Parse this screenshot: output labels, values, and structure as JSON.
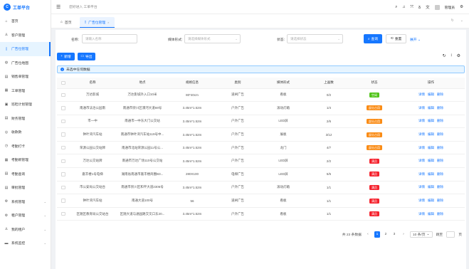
{
  "app": {
    "logo_letter": "C",
    "title": "工单平台"
  },
  "header": {
    "welcome": "您好进入 工单平台",
    "user": "管理员"
  },
  "sidebar": {
    "items": [
      {
        "label": "首页",
        "icon": "home-icon",
        "glyph": "⌂"
      },
      {
        "label": "客户管理",
        "icon": "user-icon",
        "glyph": "♙"
      },
      {
        "label": "广告位管理",
        "icon": "ad-slot-icon",
        "glyph": "▯",
        "active": true
      },
      {
        "label": "广告位地图",
        "icon": "globe-icon",
        "glyph": "◍"
      },
      {
        "label": "销售单管理",
        "icon": "file-icon",
        "glyph": "▤"
      },
      {
        "label": "工单管理",
        "icon": "ticket-icon",
        "glyph": "▦"
      },
      {
        "label": "巡检计划管理",
        "icon": "calendar-icon",
        "glyph": "▣"
      },
      {
        "label": "财务管理",
        "icon": "finance-icon",
        "glyph": "▤"
      },
      {
        "label": "收款款",
        "icon": "payment-icon",
        "glyph": "◎"
      },
      {
        "label": "考勤打卡",
        "icon": "clock-icon",
        "glyph": "◷"
      },
      {
        "label": "考勤新管理",
        "icon": "calendar-check-icon",
        "glyph": "▦"
      },
      {
        "label": "考勤查询",
        "icon": "search-doc-icon",
        "glyph": "▤"
      },
      {
        "label": "审批管理",
        "icon": "approval-icon",
        "glyph": "▤"
      },
      {
        "label": "系统管理",
        "icon": "gear-icon",
        "glyph": "⚙",
        "arrow": "⌄"
      },
      {
        "label": "租户管理",
        "icon": "tenant-icon",
        "glyph": "⚙",
        "arrow": "⌄"
      },
      {
        "label": "我的租户",
        "icon": "person-icon",
        "glyph": "♙",
        "arrow": "⌄"
      },
      {
        "label": "系统监控",
        "icon": "monitor-icon",
        "glyph": "▬",
        "arrow": "⌄"
      }
    ]
  },
  "tabs": [
    {
      "label": "首页",
      "icon": "home-icon",
      "glyph": "⌂"
    },
    {
      "label": "广告位管理",
      "icon": "ad-slot-icon",
      "glyph": "▯",
      "close": "×"
    }
  ],
  "search": {
    "name_label": "名称:",
    "name_placeholder": "请输入名称",
    "media_label": "媒体形式:",
    "media_placeholder": "请选择媒体形式",
    "status_label": "状态:",
    "status_placeholder": "请选择状态",
    "search_btn": "查询",
    "reset_btn": "重置",
    "expand": "展开"
  },
  "toolbar": {
    "add": "新增",
    "export": "导出"
  },
  "alert": {
    "text": "未选中任何数据"
  },
  "table": {
    "headers": [
      "名称",
      "地点",
      "规格信息",
      "类别",
      "媒体形式",
      "上画数",
      "状态",
      "操作"
    ],
    "ops": [
      "详情",
      "编辑",
      "删除"
    ],
    "rows": [
      {
        "name": "万达影城",
        "location": "万达影城外入口10米",
        "spec": "80*40cm",
        "category": "道闸广告",
        "media": "看板",
        "count": "0/2",
        "status": "空闲",
        "status_class": "st-green"
      },
      {
        "name": "南通市法治公园南",
        "location": "南通市崇川区濠河大道69号",
        "spec": "3.45m*1.52m",
        "category": "户外广告",
        "media": "滚动灯箱",
        "count": "1/4",
        "status": "部分占用",
        "status_class": "st-orange"
      },
      {
        "name": "市一中",
        "location": "南通市一中东大门公交站",
        "spec": "3.45m*1.52m",
        "category": "户外广告",
        "media": "LED屏",
        "count": "2/6",
        "status": "部分占用",
        "status_class": "st-orange"
      },
      {
        "name": "钟叶湾汽车站",
        "location": "南通市钟叶湾汽车站119号中...",
        "spec": "3.45m*1.52m",
        "category": "户外广告",
        "media": "展板",
        "count": "3/12",
        "status": "部分占用",
        "status_class": "st-orange"
      },
      {
        "name": "荣源公园公交站牌",
        "location": "南通市北站荣源公园11号公...",
        "spec": "3.45m*1.52m",
        "category": "户外广告",
        "media": "龙门",
        "count": "4/7",
        "status": "部分占用",
        "status_class": "st-orange"
      },
      {
        "name": "万达公交站牌",
        "location": "南通市万达广场110号公交站",
        "spec": "3.45m*1.52m",
        "category": "户外广告",
        "media": "LED屏",
        "count": "2/2",
        "status": "满员",
        "status_class": "st-red"
      },
      {
        "name": "嘉丰楼1号电梯",
        "location": "湖南省南通市嘉丰楼商圈B3...",
        "spec": "280X100",
        "category": "电梯广告",
        "media": "LED屏",
        "count": "5/5",
        "status": "满员",
        "status_class": "st-red"
      },
      {
        "name": "市公安局公交站台",
        "location": "南通市崇川区和平大道2306号",
        "spec": "3.45m*1.52m",
        "category": "户外广告",
        "media": "滚动灯箱",
        "count": "1/1",
        "status": "满员",
        "status_class": "st-red"
      },
      {
        "name": "钟叶湾汽车站",
        "location": "南通大道100号",
        "spec": "56",
        "category": "道闸广告",
        "media": "看板",
        "count": "1/1",
        "status": "满员",
        "status_class": "st-red"
      },
      {
        "name": "区随区教育局公交站台",
        "location": "区随大道与通园路交叉口东20...",
        "spec": "3.45m*1.52m",
        "category": "户外广告",
        "media": "看板",
        "count": "1/1",
        "status": "满员",
        "status_class": "st-red"
      }
    ]
  },
  "pager": {
    "total": "共 23 条数据",
    "pages": [
      "1",
      "2",
      "3"
    ],
    "current": "1",
    "prev": "‹",
    "next": "›",
    "size": "10 条/页",
    "jump_label": "跳至",
    "page_suffix": "页"
  },
  "colors": {
    "primary": "#1677ff",
    "free": "#52c41a",
    "partial": "#fa8c16",
    "full": "#f5222d"
  }
}
